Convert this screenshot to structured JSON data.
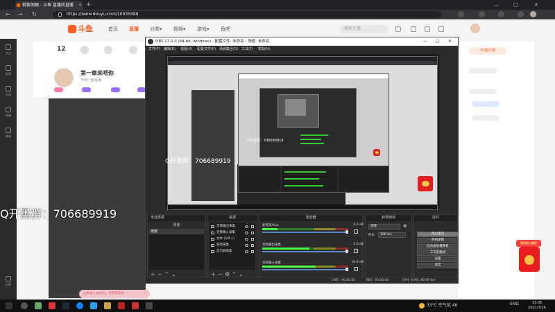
{
  "browser": {
    "tab_title": "柳絮阁跟 - 斗鱼 直播间直播",
    "url": "https://www.douyu.com/10035589"
  },
  "site": {
    "logo": "斗鱼",
    "nav": [
      "首页",
      "直播",
      "分类▾",
      "视频▾",
      "游戏▾",
      "鱼吧"
    ],
    "search_placeholder": "搜索主播",
    "level": "12",
    "room_title": "第一章来吧你",
    "room_meta": "与你一起看海",
    "pc_button": "PC客户端"
  },
  "sidebar": {
    "items": [
      "关注",
      "推荐",
      "分类",
      "直播",
      "赛事",
      "设置"
    ]
  },
  "obs": {
    "title": "OBS 27.0.0 (64-bit, windows) - 配置文件: 未命名 - 场景: 未命名",
    "menu": [
      "文件(F)",
      "编辑(E)",
      "视图(V)",
      "配置文件(P)",
      "场景集合(S)",
      "工具(T)",
      "帮助(H)"
    ],
    "docks": {
      "scenes_title": "场景",
      "scene_items": [
        "场景"
      ],
      "sources_title": "来源",
      "source_items": [
        "音频输出采集",
        "音频输入采集",
        "文本 (GDI+)",
        "游戏采集",
        "显示器采集"
      ],
      "mixer_title": "混音器",
      "mixer_channels": [
        {
          "name": "麦克风/Aux",
          "db": "0.0 dB"
        },
        {
          "name": "音频输出采集",
          "db": "0.0 dB"
        },
        {
          "name": "音频输入采集",
          "db": "10.9 dB"
        }
      ],
      "transitions_title": "转场特效",
      "transition_type": "渐变",
      "duration_label": "时长",
      "duration_value": "300 ms",
      "controls_title": "控件",
      "control_buttons": [
        "停止推流",
        "开始录制",
        "启动虚拟摄像机",
        "工作室模式",
        "设置",
        "退出"
      ]
    },
    "status": {
      "live_label": "LIVE:",
      "live_time": "00:00:00",
      "rec_label": "REC:",
      "rec_time": "00:00:00",
      "cpu": "CPU: 0.0%, 60.00 fps"
    },
    "scene_filter_label": "筛选器"
  },
  "overlay": {
    "qq_text": "Q开黑群：706689919",
    "promo_label": "狂欢送入群们",
    "chat_bubble": "立即进入本房间，可获得奖励"
  },
  "taskbar": {
    "weather": "33°C 空气优 46",
    "lang": "ENG",
    "time": "13:05",
    "date": "2021/7/26"
  },
  "colors": {
    "douyu_orange": "#ff5d23",
    "obs_dark": "#2b2b2b",
    "meter_green": "#4cff4c"
  },
  "mixer_levels": [
    0.18,
    0.55,
    0.62
  ]
}
